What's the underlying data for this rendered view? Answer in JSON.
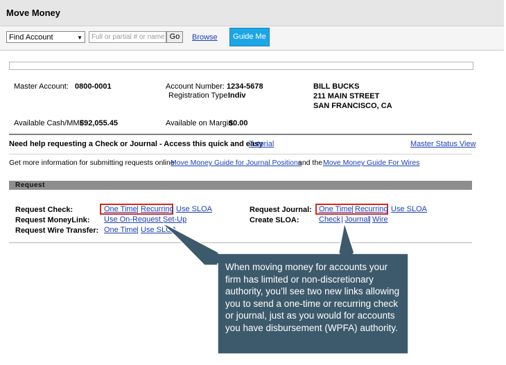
{
  "page_title": "Move Money",
  "toolbar": {
    "find_select_value": "Find Account",
    "search_placeholder": "Full or partial # or name",
    "go_label": "Go",
    "browse_label": "Browse",
    "guide_me_label": "Guide Me"
  },
  "account": {
    "master_account_label": "Master Account:",
    "master_account_value": "0800-0001",
    "account_number_label": "Account Number:",
    "account_number_value": "1234-5678",
    "registration_type_label": "Registration Type:",
    "registration_type_value": "Indiv",
    "address_lines": [
      "BILL BUCKS",
      "211 MAIN STREET",
      "SAN FRANCISCO, CA"
    ],
    "available_cash_label": "Available Cash/MMF:",
    "available_cash_value": "$92,055.45",
    "available_margin_label": "Available on Margin:",
    "available_margin_value": "$0.00"
  },
  "help": {
    "text": "Need help requesting a Check or Journal - Access this quick and easy",
    "tutorial_link": "Tutorial",
    "master_status_link": "Master Status View",
    "info_prefix": "Get more information for submitting requests online",
    "guide_journal_link": "Move Money Guide for Journal Positions",
    "info_and": "and the",
    "guide_wires_link": "Move Money Guide For Wires"
  },
  "request": {
    "section_title": "Request",
    "check_label": "Request Check:",
    "check_one_time": "One Time",
    "check_recurring": "Recurring",
    "check_use_sloa": "Use SLOA",
    "moneylink_label": "Request MoneyLink:",
    "moneylink_setup": "Use On-Request Set-Up",
    "wire_label": "Request Wire Transfer:",
    "wire_one_time": "One Time",
    "wire_use_sloa": "Use SLOA",
    "journal_label": "Request Journal:",
    "journal_one_time": "One Time",
    "journal_recurring": "Recurring",
    "journal_use_sloa": "Use SLOA",
    "sloa_label": "Create SLOA:",
    "sloa_check": "Check",
    "sloa_journal": "Journal",
    "sloa_wire": "Wire",
    "divider": "|"
  },
  "callout": {
    "text": "When moving money for accounts your firm has limited or non-discretionary authority, you’ll see two new links allowing you to send a one-time or recurring check or journal, just as you would for accounts you have disbursement (WPFA) authority.",
    "bg_color": "#3d5a6c"
  },
  "colors": {
    "link": "#1a3fb8",
    "highlight_box": "#d9261c",
    "guide_button": "#1da6e6"
  }
}
